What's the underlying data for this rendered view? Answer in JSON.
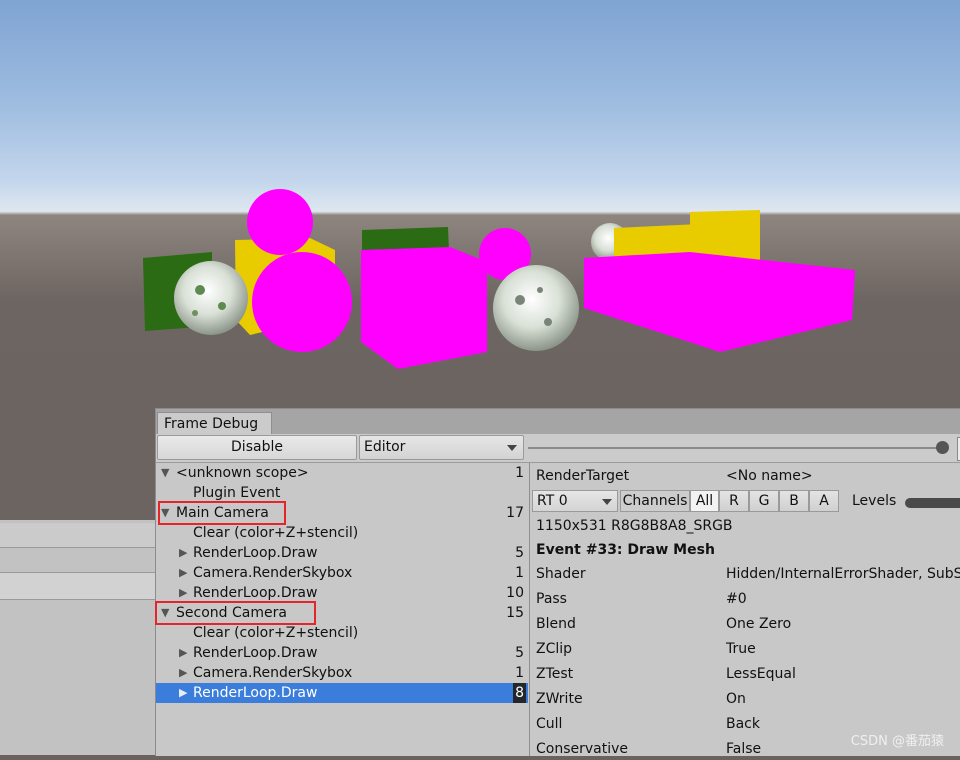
{
  "window": {
    "tab_title": "Frame Debug"
  },
  "toolbar": {
    "disable_label": "Disable",
    "target_select": "Editor"
  },
  "tree": [
    {
      "label": "<unknown scope>",
      "count": "1",
      "expanded": true
    },
    {
      "label": "Plugin Event",
      "count": ""
    },
    {
      "label": "Main Camera",
      "count": "17",
      "expanded": true,
      "highlighted": true
    },
    {
      "label": "Clear (color+Z+stencil)",
      "count": ""
    },
    {
      "label": "RenderLoop.Draw",
      "count": "5"
    },
    {
      "label": "Camera.RenderSkybox",
      "count": "1"
    },
    {
      "label": "RenderLoop.Draw",
      "count": "10"
    },
    {
      "label": "Second Camera",
      "count": "15",
      "expanded": true,
      "highlighted": true
    },
    {
      "label": "Clear (color+Z+stencil)",
      "count": ""
    },
    {
      "label": "RenderLoop.Draw",
      "count": "5"
    },
    {
      "label": "Camera.RenderSkybox",
      "count": "1"
    },
    {
      "label": "RenderLoop.Draw",
      "count": "8",
      "selected": true
    }
  ],
  "details": {
    "render_target_label": "RenderTarget",
    "render_target_value": "<No name>",
    "rt_select": "RT 0",
    "channels_label": "Channels",
    "channels": [
      "All",
      "R",
      "G",
      "B",
      "A"
    ],
    "levels_label": "Levels",
    "format": "1150x531 R8G8B8A8_SRGB",
    "event_title": "Event #33: Draw Mesh",
    "props": [
      {
        "name": "Shader",
        "value": "Hidden/InternalErrorShader, SubS"
      },
      {
        "name": "Pass",
        "value": "#0"
      },
      {
        "name": "Blend",
        "value": "One Zero"
      },
      {
        "name": "ZClip",
        "value": "True"
      },
      {
        "name": "ZTest",
        "value": "LessEqual"
      },
      {
        "name": "ZWrite",
        "value": "On"
      },
      {
        "name": "Cull",
        "value": "Back"
      },
      {
        "name": "Conservative",
        "value": "False"
      }
    ]
  },
  "watermark": "CSDN @番茄猿",
  "colors": {
    "magenta": "#ff00ff",
    "yellow": "#e8cc00",
    "green": "#2a6b14",
    "selection": "#3b7ddb",
    "highlight_box": "#e4262b"
  }
}
